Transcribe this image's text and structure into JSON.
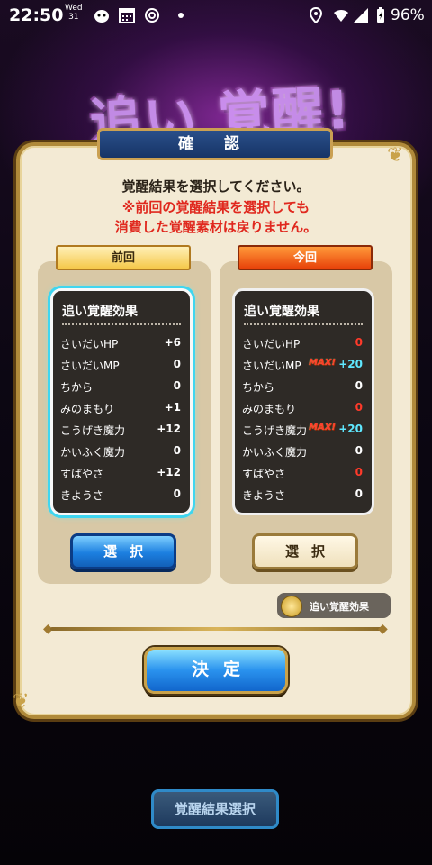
{
  "status_bar": {
    "time": "22:50",
    "date_day": "Wed",
    "date_num": "31",
    "battery": "96%"
  },
  "banner": {
    "title": "追い 覚醒!"
  },
  "dialog": {
    "title": "確 認",
    "message": "覚醒結果を選択してください。",
    "warning_line1": "※前回の覚醒結果を選択しても",
    "warning_line2": "消費した覚醒素材は戻りません。"
  },
  "previous": {
    "ribbon": "前回",
    "card_title": "追い覚醒効果",
    "rows": [
      {
        "label": "さいだいHP",
        "value": "+6"
      },
      {
        "label": "さいだいMP",
        "value": "0"
      },
      {
        "label": "ちから",
        "value": "0"
      },
      {
        "label": "みのまもり",
        "value": "+1"
      },
      {
        "label": "こうげき魔力",
        "value": "+12"
      },
      {
        "label": "かいふく魔力",
        "value": "0"
      },
      {
        "label": "すばやさ",
        "value": "+12"
      },
      {
        "label": "きようさ",
        "value": "0"
      }
    ],
    "select_label": "選択"
  },
  "current": {
    "ribbon": "今回",
    "card_title": "追い覚醒効果",
    "max_badge": "MAX!",
    "rows": [
      {
        "label": "さいだいHP",
        "value": "0"
      },
      {
        "label": "さいだいMP",
        "value": "+20"
      },
      {
        "label": "ちから",
        "value": "0"
      },
      {
        "label": "みのまもり",
        "value": "0"
      },
      {
        "label": "こうげき魔力",
        "value": "+20"
      },
      {
        "label": "かいふく魔力",
        "value": "0"
      },
      {
        "label": "すばやさ",
        "value": "0"
      },
      {
        "label": "きようさ",
        "value": "0"
      }
    ],
    "select_label": "選択"
  },
  "legend": {
    "label": "追い覚醒効果"
  },
  "decide_label": "決定",
  "bottom_button": "覚醒結果選択",
  "colors": {
    "red_value": "#ff3a2a",
    "cyan_value": "#5fe8ff",
    "selected_glow": "#3fd6f0"
  }
}
